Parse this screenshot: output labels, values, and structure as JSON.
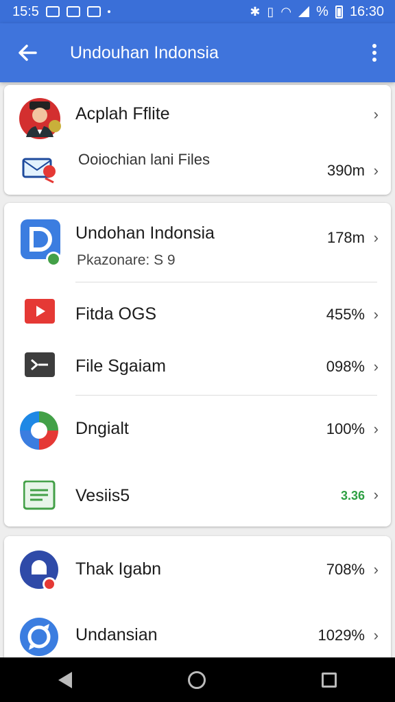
{
  "status_bar": {
    "time_left": "15:5",
    "battery_percent": "%",
    "time_right": "16:30"
  },
  "app_bar": {
    "title": "Undouhan Indonsia"
  },
  "card1": {
    "item1": {
      "label": "Acplah Fflite"
    },
    "item2": {
      "label": "Ooiochian lani Files",
      "value": "390m"
    }
  },
  "card2": {
    "item1": {
      "label": "Undohan Indonsia",
      "sub": "Pkazonare: S 9",
      "value": "178m"
    },
    "item2": {
      "label": "Fitda OGS",
      "value": "455%"
    },
    "item3": {
      "label": "File Sgaiam",
      "value": "098%"
    },
    "item4": {
      "label": "Dngialt",
      "value": "100%"
    },
    "item5": {
      "label": "Vesiis5",
      "value": "3.36",
      "value_color": "#2ea043"
    }
  },
  "card3": {
    "item1": {
      "label": "Thak Igabn",
      "value": "708%"
    },
    "item2": {
      "label": "Undansian",
      "value": "1029%"
    }
  },
  "colors": {
    "app_bar": "#3f74dc",
    "status_bar": "#3a6fd8",
    "youtube_red": "#e53935",
    "doc_blue": "#3b7de0",
    "notes_green": "#43a047"
  }
}
